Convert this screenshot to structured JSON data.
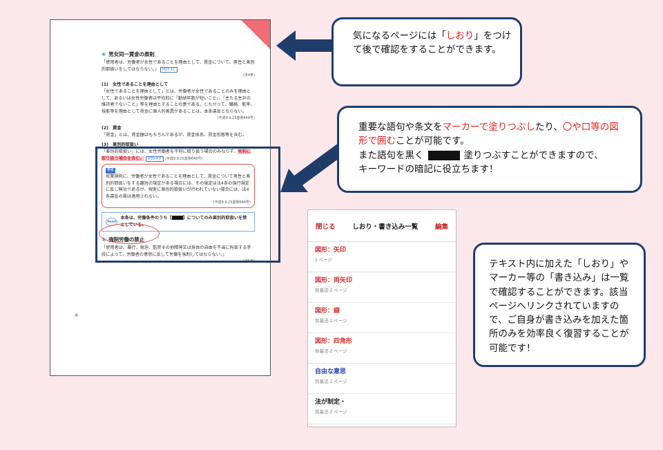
{
  "document": {
    "section4": {
      "num": "④",
      "title": "男女同一賃金の原則",
      "text": "「使用者は、労働者が女性であることを理由として、賃金について、男性と差別的取扱いをしてはならない。」",
      "ref": "H27-1C",
      "cite": "(法4条)"
    },
    "item1": {
      "label": "(1)　女性であることを理由として",
      "text": "「女性であることを理由として」とは、労働者が女性であることのみを理由として、あるいは女性労働者は平均的に「勤続年数が短いこと」、「主たる生計の維持者でないこと」等を理由とすることの意である。したがって、職務、能率、技能等を理由として賃金に個人的差異があることは、本条違反とならない。",
      "cite": "(平成9.9.25基発648号)"
    },
    "item2": {
      "label": "(2)　賃金",
      "text": "「賃金」とは、賃金額はもちろんであるが、賃金体系、賃金形態等を含む。"
    },
    "item3": {
      "label": "(3)　差別的取扱い",
      "text": "「差別的取扱い」には、女性労働者を不利に取り扱う場合のみならず、",
      "highlight": "有利に取り扱う場合を含む。",
      "ref": "H30-4子",
      "cite": "(平成9.9.25基発648号)"
    },
    "case": {
      "tag": "参考",
      "text": "就業規則に、労働者が女性であることを理由として、賃金について男性と差別的取扱いをする趣旨の規定がある場合には、その規定は法4条の強行規定に反し無効であるが、現実に差別的取扱いが行われていない場合には、法4条違反の罪は適用されない。",
      "cite": "(平成9.9.25基発648号)"
    },
    "point": {
      "badge": "Point",
      "text_before": "本条は、労働条件のうち【",
      "text_after": "】についてのみ差別的取扱いを禁止している。"
    },
    "section5": {
      "num": "⑤",
      "title": "強制労働の禁止",
      "text": "「使用者は、暴行、脅迫、監禁その他精神又は身体の自由を不当に拘束する手段によって、労働者の意思に反して労働を強制してはならない。」",
      "cite": "(法5条)"
    },
    "page_number": "6"
  },
  "callouts": {
    "bookmark": {
      "pre": "気になるページには「",
      "red": "しおり",
      "post": "」をつけて後で確認をすることができます。"
    },
    "marker": {
      "pre": "重要な語句や条文を",
      "red1": "マーカーで塗りつぶし",
      "mid": "たり、",
      "red2": "〇や口等の図形で囲む",
      "post": "ことが可能です。",
      "line2_pre": "また語句を黒く",
      "line2_post": "塗りつぶすことができますので、",
      "line3": "キーワードの暗記に役立ちます！"
    },
    "review": {
      "text": "テキスト内に加えた「しおり」やマーカー等の「書き込み」は一覧で確認することができます。該当ページへリンクされていますので、ご自身が書き込みを加えた箇所のみを効率良く復習することが可能です！"
    }
  },
  "panel": {
    "close_label": "閉じる",
    "title": "しおり・書き込み一覧",
    "edit_label": "編集",
    "items": [
      {
        "title": "図形：矢印",
        "sub": "1 ページ",
        "color": "#d32f2f"
      },
      {
        "title": "図形：両矢印",
        "sub": "労基法-2 ページ",
        "color": "#d32f2f"
      },
      {
        "title": "図形：線",
        "sub": "労基法-2 ページ",
        "color": "#d32f2f"
      },
      {
        "title": "図形：四角形",
        "sub": "労基法-2 ページ",
        "color": "#d32f2f"
      },
      {
        "title": "自由な意思",
        "sub": "労基法-2 ページ",
        "color": "#2f47b5"
      },
      {
        "title": "法が制定・",
        "sub": "労基法-2 ページ",
        "color": "#222222"
      }
    ]
  },
  "colors": {
    "background": "#fce8ea",
    "accent_navy": "#1f3d6b",
    "bookmark_red": "#ef6d76",
    "text_red": "#e02020"
  }
}
